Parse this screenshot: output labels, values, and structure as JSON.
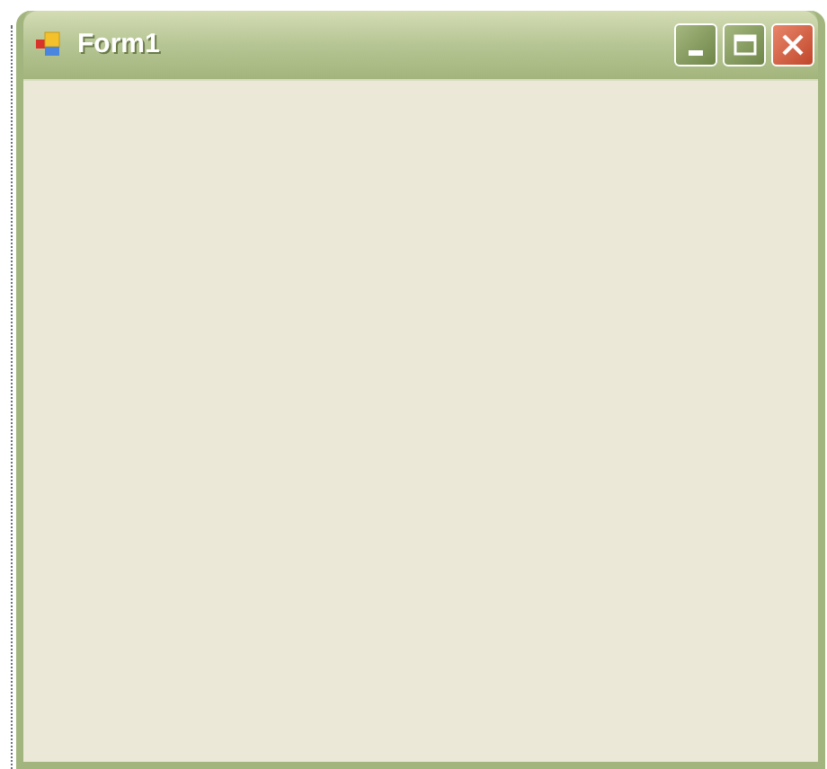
{
  "window": {
    "title": "Form1"
  }
}
